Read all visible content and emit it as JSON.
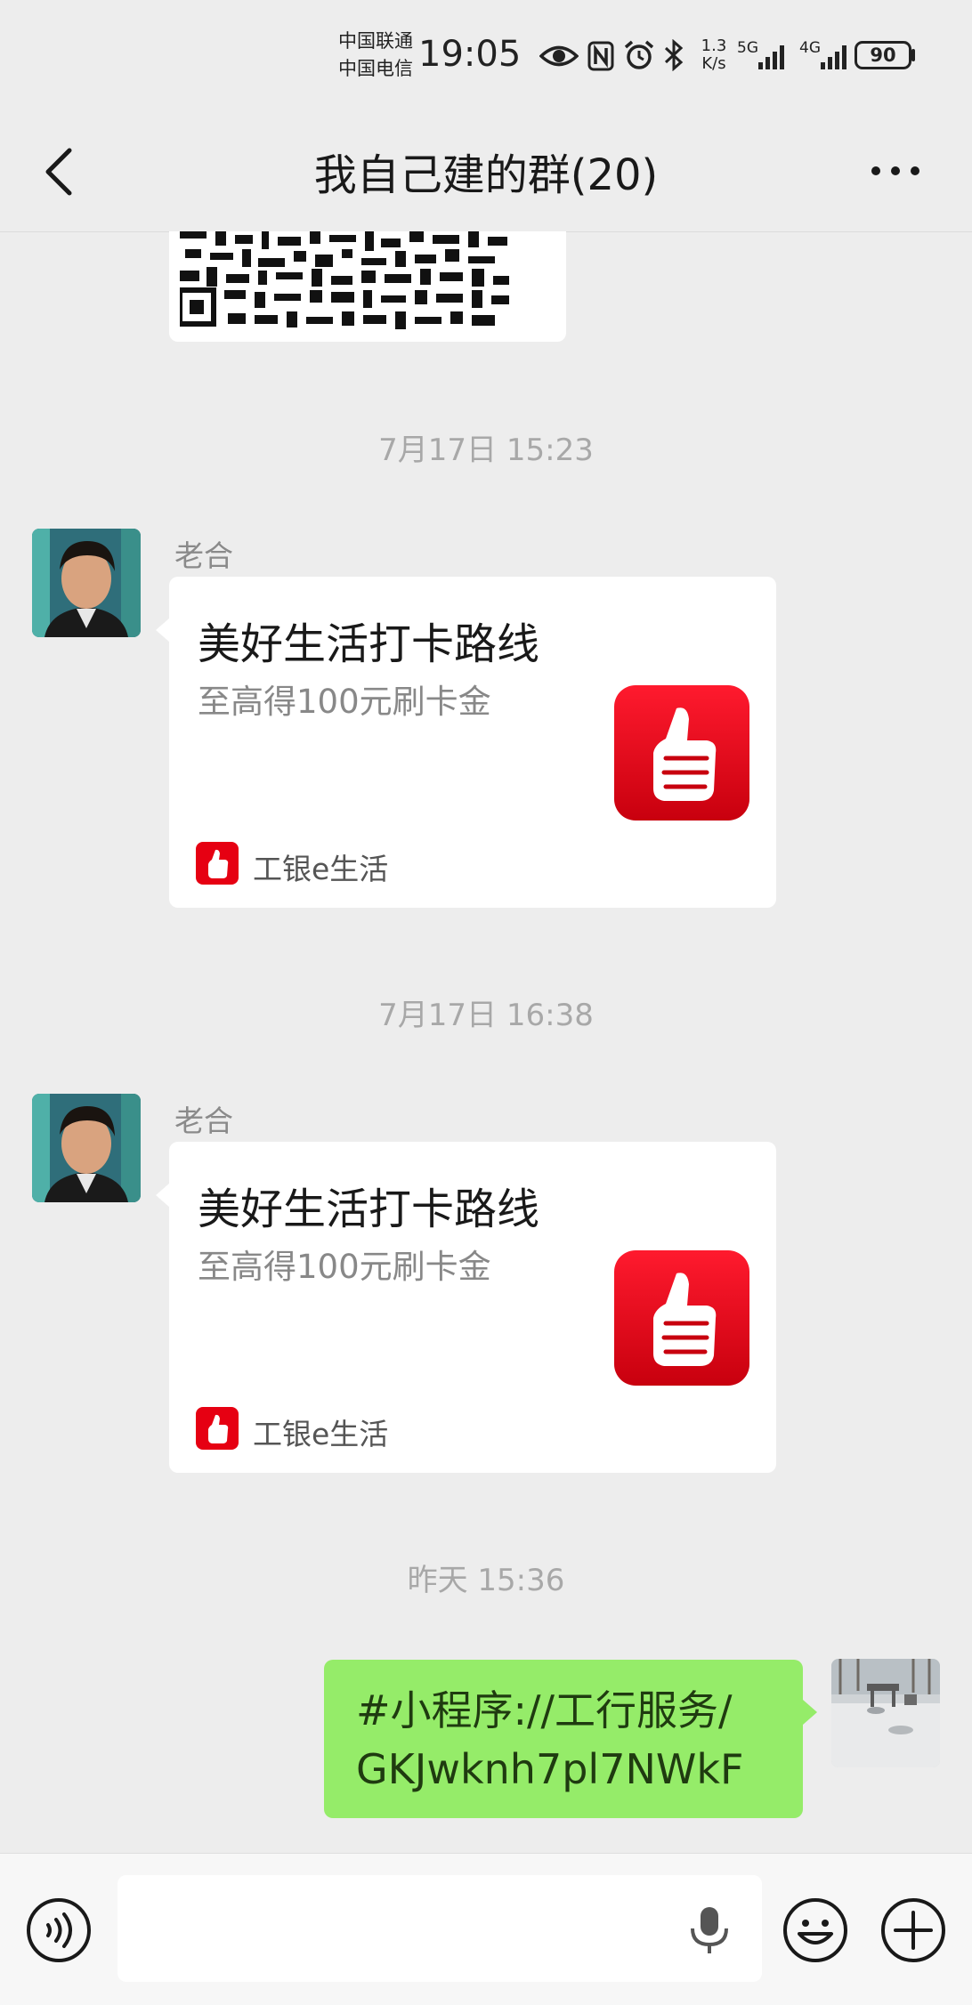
{
  "status_bar": {
    "carrier_1": "中国联通",
    "carrier_2": "中国电信",
    "time": "19:05",
    "net_speed_value": "1.3",
    "net_speed_unit": "K/s",
    "net_1": "5G",
    "net_2": "4G",
    "battery": "90"
  },
  "header": {
    "title": "我自己建的群(20)",
    "back_icon": "chevron-left-icon",
    "more_icon": "more-dots-icon"
  },
  "messages": [
    {
      "timestamp": "7月17日 15:23",
      "sender": "老合",
      "card": {
        "title": "美好生活打卡路线",
        "desc": "至高得100元刷卡金",
        "source": "工银e生活",
        "icon": "thumbs-up-icon"
      }
    },
    {
      "timestamp": "7月17日 16:38",
      "sender": "老合",
      "card": {
        "title": "美好生活打卡路线",
        "desc": "至高得100元刷卡金",
        "source": "工银e生活",
        "icon": "thumbs-up-icon"
      }
    },
    {
      "timestamp": "昨天 15:36",
      "self_text_line_1": "#小程序://工行服务/",
      "self_text_line_2": "GKJwknh7pl7NWkF"
    }
  ],
  "bottom_bar": {
    "voice_icon": "voice-icon",
    "mic_icon": "mic-icon",
    "emoji_icon": "emoji-icon",
    "plus_icon": "plus-icon",
    "input_value": ""
  },
  "colors": {
    "background": "#ededed",
    "self_bubble": "#95ec69",
    "card_icon_red": "#e60012"
  }
}
